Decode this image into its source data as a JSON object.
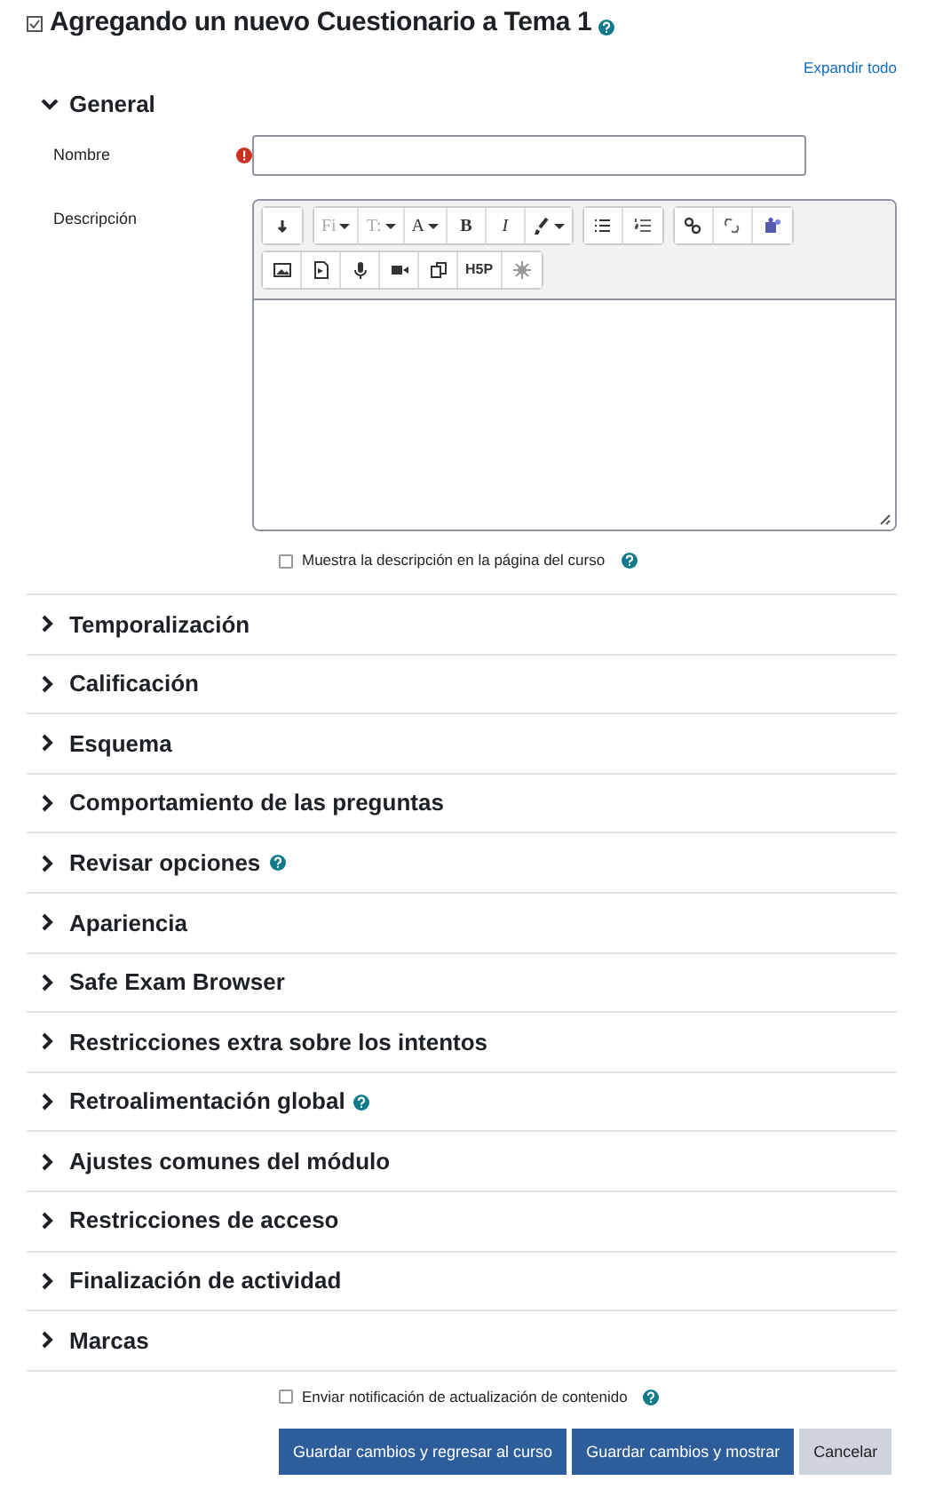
{
  "page_title": {
    "text": "Agregando un nuevo Cuestionario a Tema 1",
    "help": true
  },
  "expand_all": "Expandir todo",
  "general": {
    "title": "General",
    "expanded": true,
    "name_field": {
      "label": "Nombre",
      "required": true
    },
    "description": {
      "label": "Descripción",
      "toolbar_rows": [
        [
          [
            {
              "kind": "collapse"
            }
          ],
          [
            {
              "kind": "text",
              "label": "Fi",
              "dropdown": true,
              "disabled": true
            },
            {
              "kind": "text",
              "label": "T:",
              "dropdown": true,
              "disabled": true
            },
            {
              "kind": "text",
              "label": "A",
              "dropdown": true,
              "disabled": false
            },
            {
              "kind": "bold",
              "label": "B",
              "dropdown": false,
              "disabled": false
            },
            {
              "kind": "italic",
              "label": "I",
              "dropdown": false,
              "disabled": false
            },
            {
              "kind": "brush",
              "dropdown": true
            }
          ],
          [
            {
              "kind": "bullets"
            },
            {
              "kind": "numbers"
            }
          ],
          [
            {
              "kind": "link"
            },
            {
              "kind": "unlink"
            },
            {
              "kind": "teams"
            }
          ]
        ],
        [
          [
            {
              "kind": "image"
            },
            {
              "kind": "media"
            },
            {
              "kind": "mic"
            },
            {
              "kind": "video"
            },
            {
              "kind": "copy"
            },
            {
              "kind": "text",
              "label": "H5P",
              "dropdown": false,
              "disabled": false
            },
            {
              "kind": "gear"
            }
          ]
        ]
      ],
      "show_on_course": {
        "label": "Muestra la descripción en la página del curso",
        "checked": false,
        "help": true
      }
    }
  },
  "sections": [
    {
      "title": "Temporalización",
      "expanded": false,
      "help": false
    },
    {
      "title": "Calificación",
      "expanded": false,
      "help": false
    },
    {
      "title": "Esquema",
      "expanded": false,
      "help": false
    },
    {
      "title": "Comportamiento de las preguntas",
      "expanded": false,
      "help": false
    },
    {
      "title": "Revisar opciones",
      "expanded": false,
      "help": true
    },
    {
      "title": "Apariencia",
      "expanded": false,
      "help": false
    },
    {
      "title": "Safe Exam Browser",
      "expanded": false,
      "help": false
    },
    {
      "title": "Restricciones extra sobre los intentos",
      "expanded": false,
      "help": false
    },
    {
      "title": "Retroalimentación global",
      "expanded": false,
      "help": true
    },
    {
      "title": "Ajustes comunes del módulo",
      "expanded": false,
      "help": false
    },
    {
      "title": "Restricciones de acceso",
      "expanded": false,
      "help": false
    },
    {
      "title": "Finalización de actividad",
      "expanded": false,
      "help": false
    },
    {
      "title": "Marcas",
      "expanded": false,
      "help": false
    }
  ],
  "notify": {
    "label": "Enviar notificación de actualización de contenido",
    "checked": false,
    "help": true
  },
  "buttons": [
    {
      "label": "Guardar cambios y regresar al curso",
      "kind": "primary"
    },
    {
      "label": "Guardar cambios y mostrar",
      "kind": "primary"
    },
    {
      "label": "Cancelar",
      "kind": "secondary"
    }
  ]
}
